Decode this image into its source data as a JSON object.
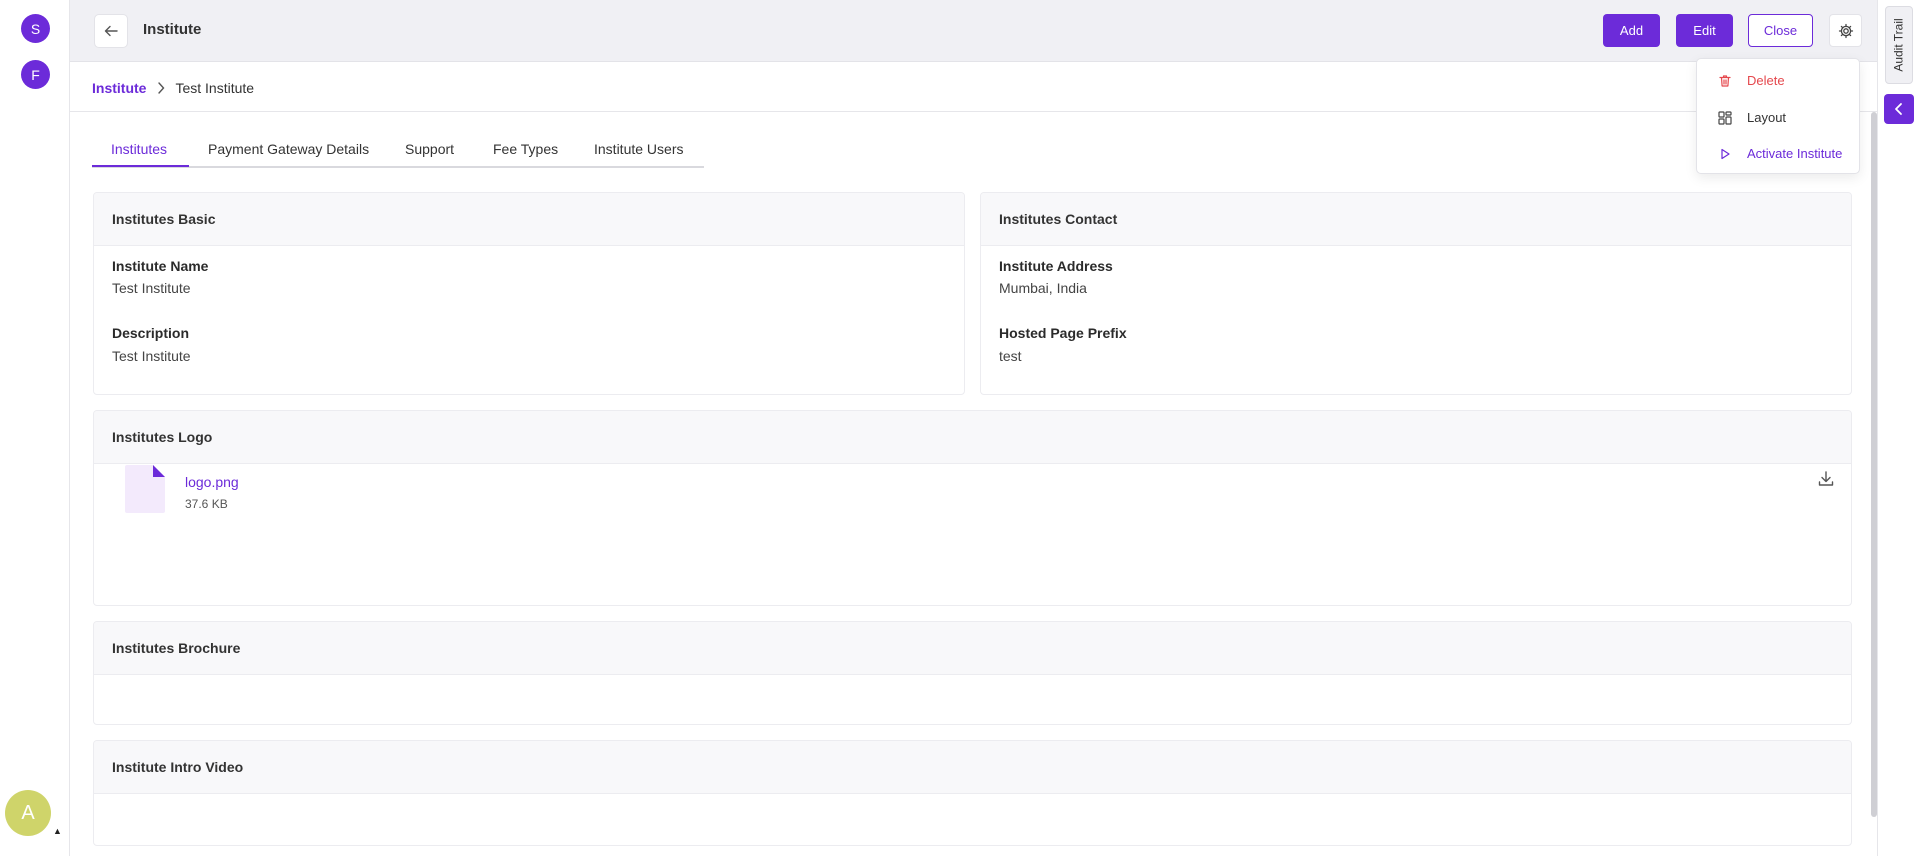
{
  "left_rail": {
    "avatars": [
      "S",
      "F"
    ],
    "user_initial": "A",
    "user_caret": "▲"
  },
  "header": {
    "title": "Institute",
    "add_label": "Add",
    "edit_label": "Edit",
    "close_label": "Close"
  },
  "breadcrumb": {
    "root": "Institute",
    "current": "Test Institute"
  },
  "tabs": [
    {
      "label": "Institutes",
      "active": true
    },
    {
      "label": "Payment Gateway Details",
      "active": false
    },
    {
      "label": "Support",
      "active": false
    },
    {
      "label": "Fee Types",
      "active": false
    },
    {
      "label": "Institute Users",
      "active": false
    }
  ],
  "sections": {
    "basic": {
      "title": "Institutes Basic",
      "fields": [
        {
          "label": "Institute Name",
          "value": "Test Institute"
        },
        {
          "label": "Description",
          "value": "Test Institute"
        }
      ]
    },
    "contact": {
      "title": "Institutes Contact",
      "fields": [
        {
          "label": "Institute Address",
          "value": "Mumbai, India"
        },
        {
          "label": "Hosted Page Prefix",
          "value": "test"
        }
      ]
    },
    "logo": {
      "title": "Institutes Logo",
      "file_name": "logo.png",
      "file_size": "37.6 KB"
    },
    "brochure": {
      "title": "Institutes Brochure"
    },
    "intro_video": {
      "title": "Institute Intro Video"
    }
  },
  "right_panel": {
    "audit_trail_label": "Audit Trail"
  },
  "settings_menu": {
    "items": [
      {
        "label": "Delete",
        "icon": "trash-icon",
        "color": "#e5484d"
      },
      {
        "label": "Layout",
        "icon": "layout-grid-icon",
        "color": "#333333"
      },
      {
        "label": "Activate Institute",
        "icon": "play-icon",
        "color": "#6c2bd9"
      }
    ]
  },
  "colors": {
    "accent": "#6c2bd9",
    "danger": "#e5484d",
    "user_avatar": "#cfd46a"
  }
}
